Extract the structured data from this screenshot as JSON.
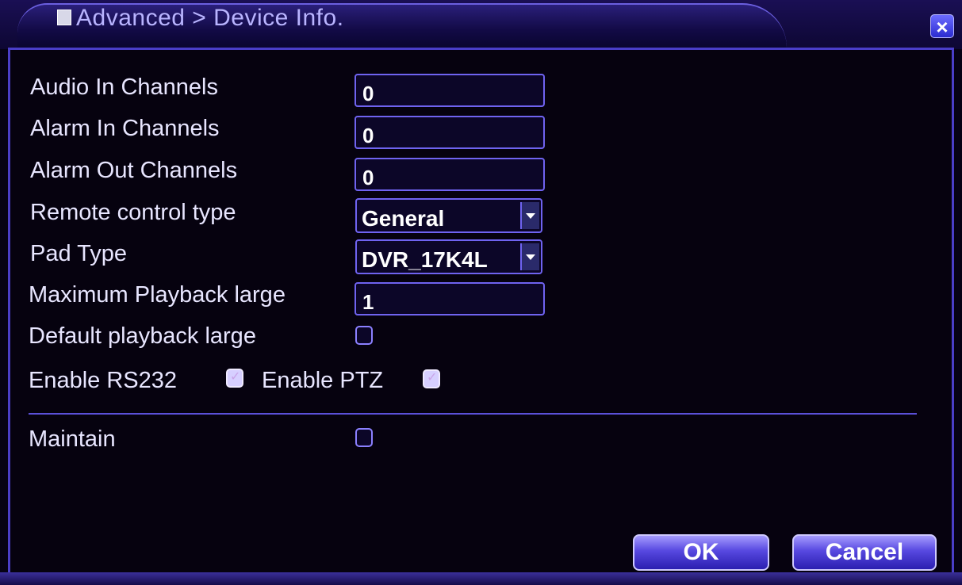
{
  "window": {
    "breadcrumb": "Advanced > Device Info.",
    "close_glyph": "×"
  },
  "fields": {
    "audio_in": {
      "label": "Audio In Channels",
      "value": "0"
    },
    "alarm_in": {
      "label": "Alarm In Channels",
      "value": "0"
    },
    "alarm_out": {
      "label": "Alarm Out Channels",
      "value": "0"
    },
    "remote_control": {
      "label": "Remote control type",
      "value": "General"
    },
    "pad_type": {
      "label": "Pad Type",
      "value": "DVR_17K4L"
    },
    "max_playback": {
      "label": "Maximum Playback large",
      "value": "1"
    },
    "default_playback": {
      "label": "Default playback large",
      "checked": false
    },
    "enable_rs232": {
      "label": "Enable RS232",
      "checked": true
    },
    "enable_ptz": {
      "label": "Enable PTZ",
      "checked": true
    },
    "maintain": {
      "label": "Maintain",
      "checked": false
    }
  },
  "buttons": {
    "ok": "OK",
    "cancel": "Cancel"
  },
  "colors": {
    "accent": "#6f63f0",
    "background": "#06020f",
    "text": "#e8e6ff"
  }
}
